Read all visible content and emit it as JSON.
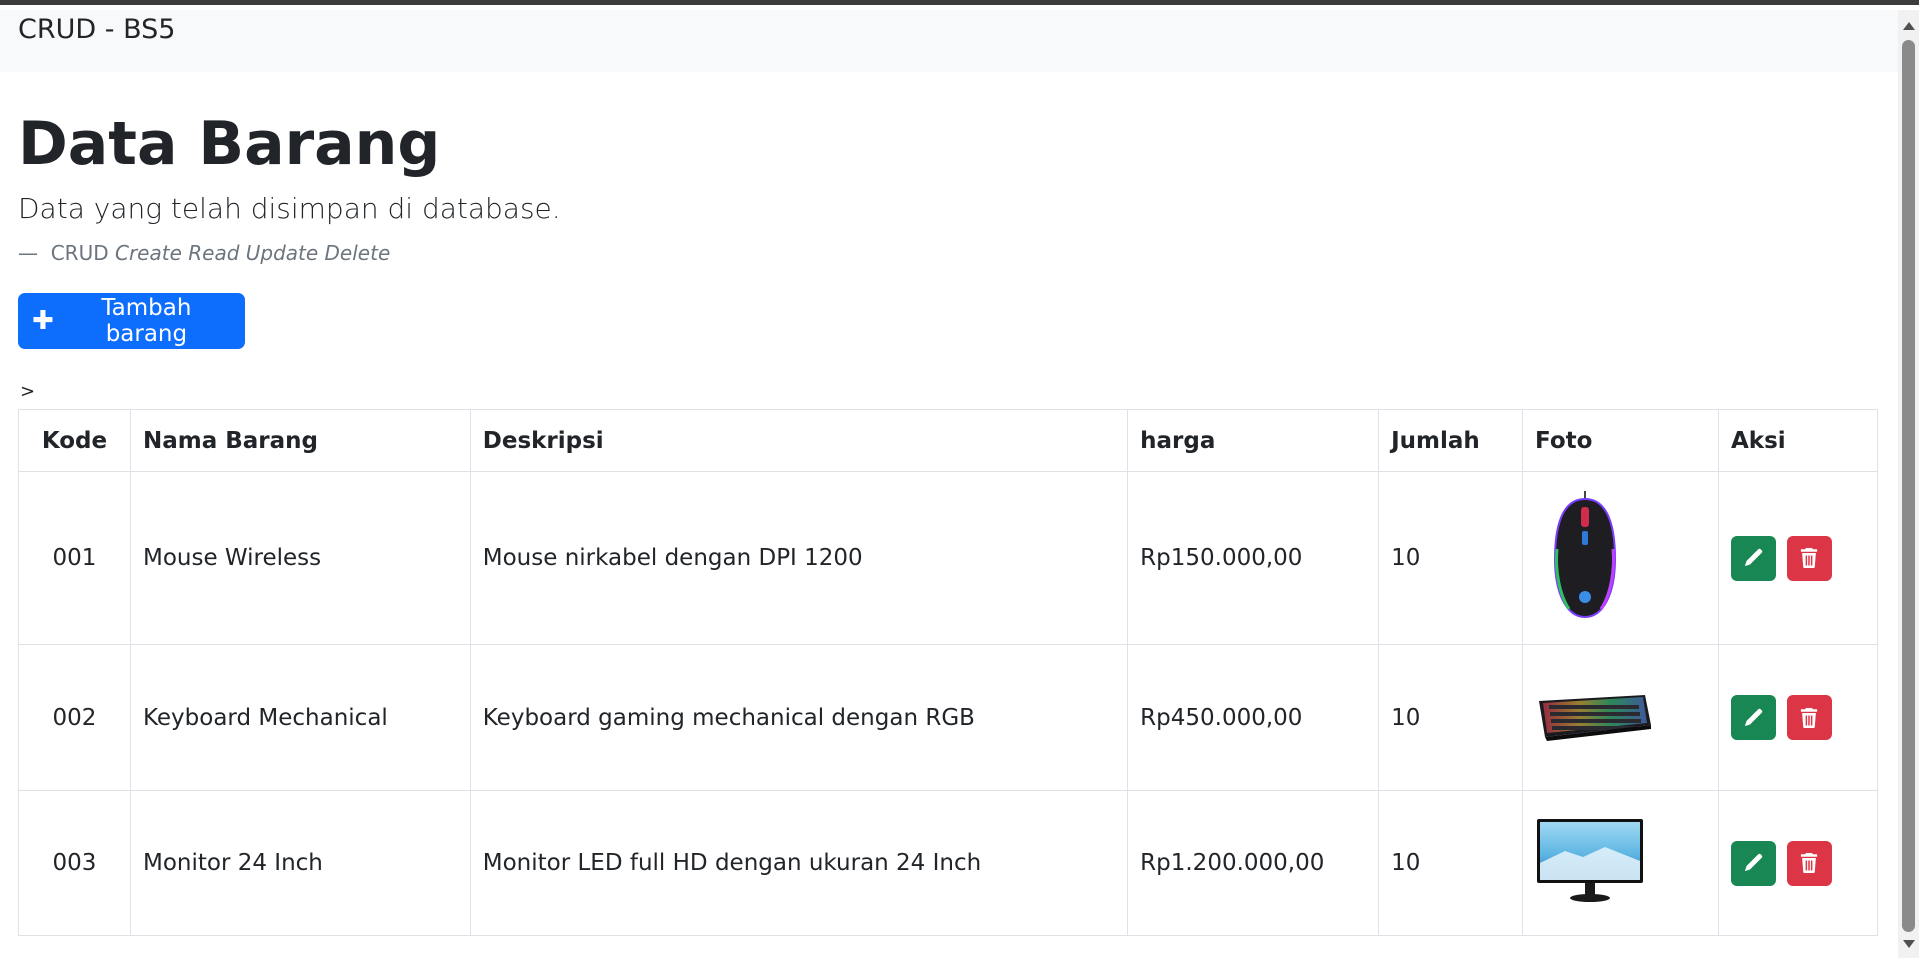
{
  "navbar": {
    "brand": "CRUD - BS5"
  },
  "page": {
    "title": "Data Barang",
    "lead": "Data yang telah disimpan di database.",
    "quote_dash": "—",
    "quote_source": "CRUD",
    "quote_cite": "Create Read Update Delete",
    "add_button_label": "Tambah barang",
    "stray_text": ">"
  },
  "table": {
    "headers": [
      "Kode",
      "Nama Barang",
      "Deskripsi",
      "harga",
      "Jumlah",
      "Foto",
      "Aksi"
    ],
    "rows": [
      {
        "kode": "001",
        "nama": "Mouse Wireless",
        "deskripsi": "Mouse nirkabel dengan DPI 1200",
        "harga": "Rp150.000,00",
        "jumlah": "10",
        "foto": "mouse-photo"
      },
      {
        "kode": "002",
        "nama": "Keyboard Mechanical",
        "deskripsi": "Keyboard gaming mechanical dengan RGB",
        "harga": "Rp450.000,00",
        "jumlah": "10",
        "foto": "keyboard-photo"
      },
      {
        "kode": "003",
        "nama": "Monitor 24 Inch",
        "deskripsi": "Monitor LED full HD dengan ukuran 24 Inch",
        "harga": "Rp1.200.000,00",
        "jumlah": "10",
        "foto": "monitor-photo"
      }
    ]
  },
  "icons": {
    "add": "plus-icon",
    "edit": "pencil-icon",
    "delete": "trash-icon"
  },
  "colors": {
    "primary": "#0d6efd",
    "success": "#198754",
    "danger": "#dc3545",
    "navbar_bg": "#f8f9fa",
    "muted": "#6c757d"
  }
}
